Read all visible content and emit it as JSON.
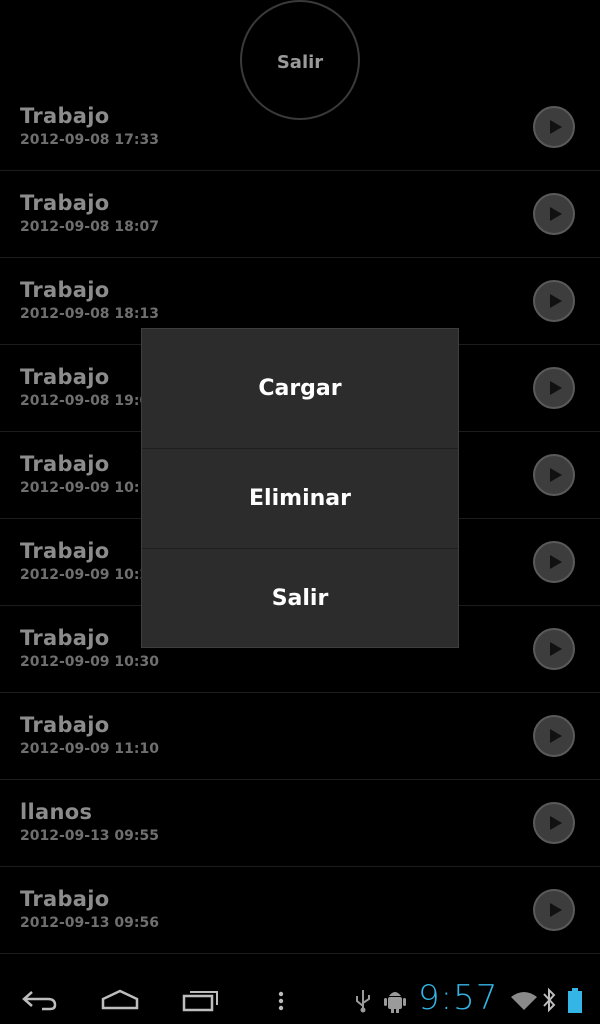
{
  "top_button": {
    "label": "Salir"
  },
  "recordings": [
    {
      "name": "Trabajo",
      "date": "2012-09-08 17:33"
    },
    {
      "name": "Trabajo",
      "date": "2012-09-08 18:07"
    },
    {
      "name": "Trabajo",
      "date": "2012-09-08 18:13"
    },
    {
      "name": "Trabajo",
      "date": "2012-09-08 19:02"
    },
    {
      "name": "Trabajo",
      "date": "2012-09-09 10:19"
    },
    {
      "name": "Trabajo",
      "date": "2012-09-09 10:28"
    },
    {
      "name": "Trabajo",
      "date": "2012-09-09 10:30"
    },
    {
      "name": "Trabajo",
      "date": "2012-09-09 11:10"
    },
    {
      "name": "llanos",
      "date": "2012-09-13 09:55"
    },
    {
      "name": "Trabajo",
      "date": "2012-09-13 09:56"
    }
  ],
  "context_menu": {
    "items": [
      {
        "label": "Cargar"
      },
      {
        "label": "Eliminar"
      },
      {
        "label": "Salir"
      }
    ]
  },
  "status_bar": {
    "time": "9:57",
    "clock_color": "#33b5e5",
    "icons": [
      "usb-icon",
      "android-debug-icon",
      "wifi-icon",
      "bluetooth-icon",
      "battery-icon"
    ]
  },
  "nav_bar": {
    "icons": [
      "back-icon",
      "home-icon",
      "recent-apps-icon",
      "overflow-menu-icon"
    ]
  }
}
